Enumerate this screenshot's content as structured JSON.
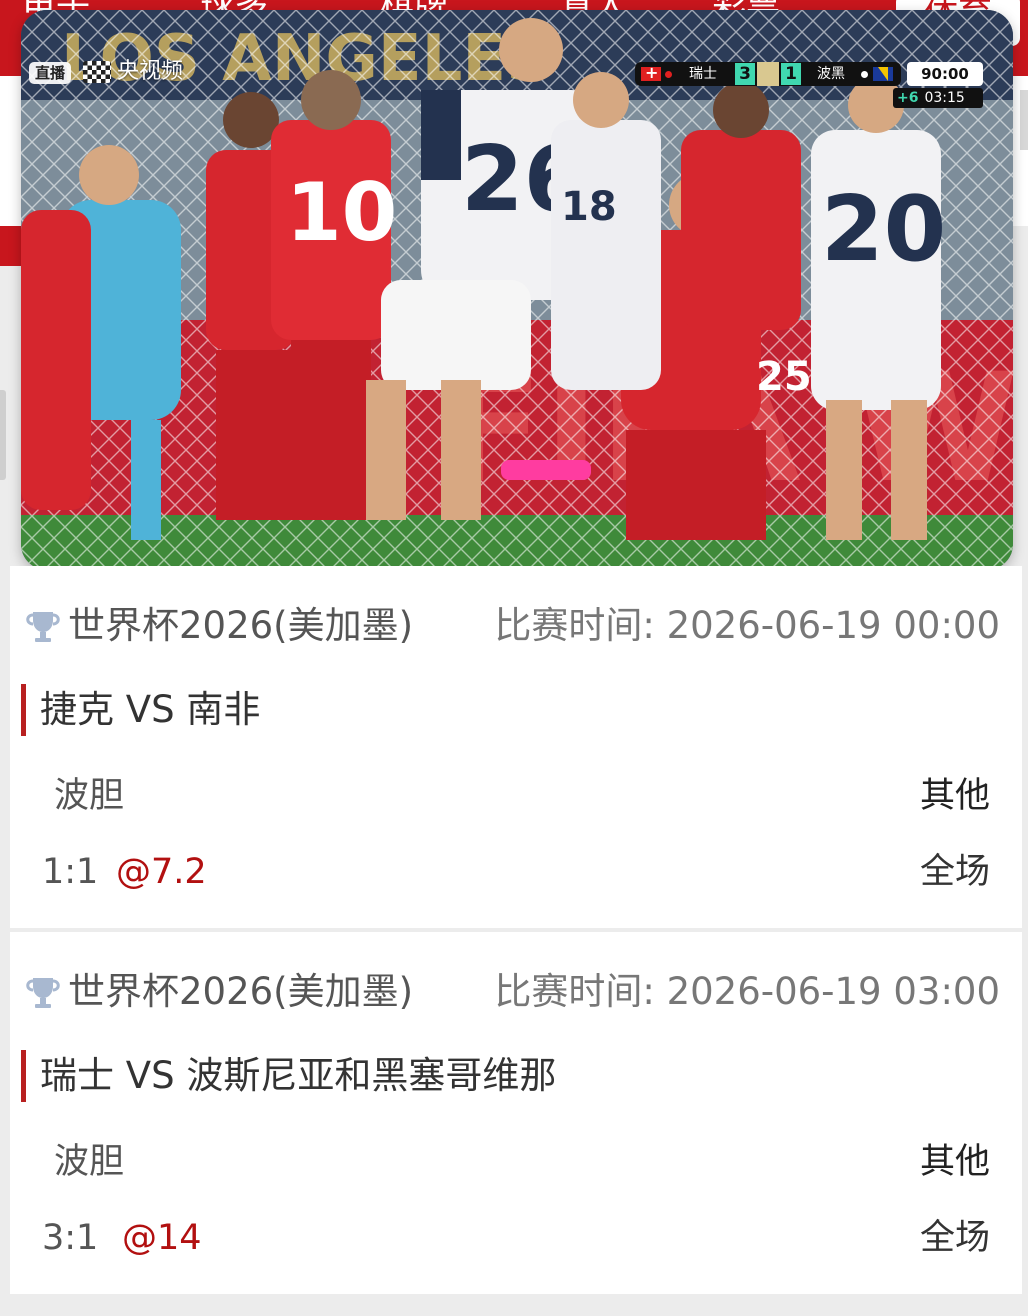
{
  "nav": {
    "items": [
      "电子",
      "球多",
      "棋牌",
      "真人",
      "彩票"
    ],
    "active": "体育"
  },
  "video": {
    "live_badge": "直播",
    "channel": "央视频",
    "scoreboard": {
      "home_team": "瑞士",
      "home_score": "3",
      "away_team": "波黑",
      "away_score": "1",
      "clock": "90:00",
      "added_time": "+6",
      "added_clock": "03:15"
    },
    "colors": {
      "swiss_red": "#d6262e",
      "bosnia_white": "#f2f2f4",
      "pitch_green": "#3f8a3a"
    }
  },
  "matches": [
    {
      "league": "世界杯2026(美加墨)",
      "time_label": "比赛时间: 2026-06-19 00:00",
      "teams": "捷克 VS 南非",
      "bet_type": "波胆",
      "other": "其他",
      "score": "1:1",
      "odds": "@7.2",
      "period": "全场"
    },
    {
      "league": "世界杯2026(美加墨)",
      "time_label": "比赛时间: 2026-06-19 03:00",
      "teams": "瑞士 VS 波斯尼亚和黑塞哥维那",
      "bet_type": "波胆",
      "other": "其他",
      "score": "3:1",
      "odds": "@14",
      "period": "全场"
    }
  ]
}
